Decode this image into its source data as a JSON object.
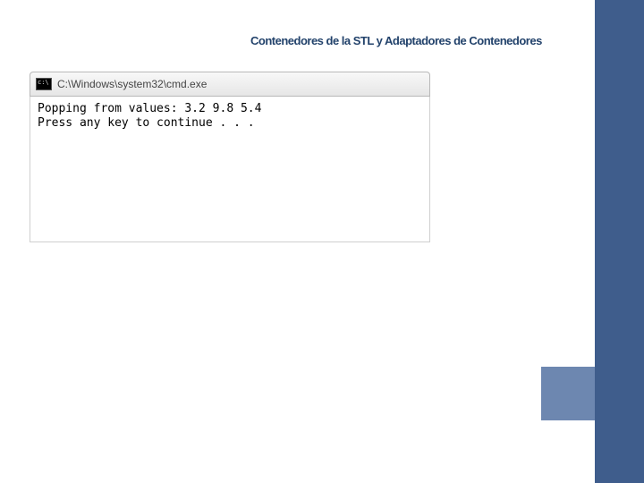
{
  "header": {
    "title": "Contenedores de la STL y Adaptadores de Contenedores"
  },
  "console": {
    "icon_name": "cmd-icon",
    "title": "C:\\Windows\\system32\\cmd.exe",
    "lines": [
      "Popping from values: 3.2 9.8 5.4",
      "Press any key to continue . . ."
    ]
  },
  "colors": {
    "sidebar": "#3f5d8c",
    "accent": "#6d87b0",
    "title": "#22426b"
  }
}
